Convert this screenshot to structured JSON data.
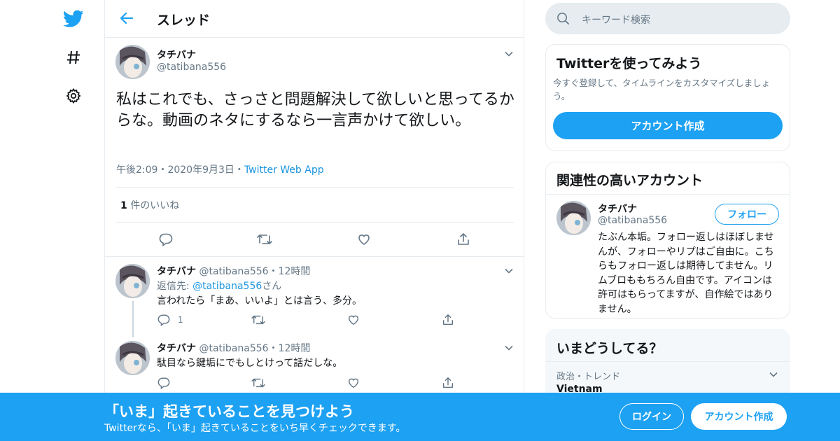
{
  "header": {
    "title": "スレッド"
  },
  "main_tweet": {
    "name": "タチバナ",
    "handle": "@tatibana556",
    "text": "私はこれでも、さっさと問題解決して欲しいと思ってるからな。動画のネタにするなら一言声かけて欲しい。",
    "time": "午後2:09",
    "date": "2020年9月3日",
    "source": "Twitter Web App",
    "dot": "・",
    "likes_count": "1",
    "likes_label": " 件のいいね"
  },
  "replies": [
    {
      "name": "タチバナ",
      "handle": "@tatibana556",
      "dot": "・",
      "time": "12時間",
      "reply_to_prefix": "返信先: ",
      "reply_to_handle": "@tatibana556",
      "reply_to_suffix": "さん",
      "text": "言われたら「まあ、いいよ」とは言う、多分。",
      "reply_count": "1"
    },
    {
      "name": "タチバナ",
      "handle": "@tatibana556",
      "dot": "・",
      "time": "12時間",
      "text": "駄目なら鍵垢にでもしとけって話だしな。"
    }
  ],
  "search": {
    "placeholder": "キーワード検索"
  },
  "signup_card": {
    "title": "Twitterを使ってみよう",
    "desc": "今すぐ登録して、タイムラインをカスタマイズしましょう。",
    "button": "アカウント作成"
  },
  "related_card": {
    "title": "関連性の高いアカウント",
    "name": "タチバナ",
    "handle": "@tatibana556",
    "follow": "フォロー",
    "bio": "たぶん本垢。フォロー返しはほぼしませんが、フォローやリプはご自由に。こちらもフォロー返しは期待してません。リムブロももちろん自由です。アイコンは許可はもらってますが、自作絵ではありません。"
  },
  "trends_card": {
    "title": "いまどうしてる？",
    "category": "政治・トレンド",
    "trend": "Vietnam"
  },
  "banner": {
    "title": "「いま」起きていることを見つけよう",
    "subtitle": "Twitterなら、「いま」起きていることをいち早くチェックできます。",
    "login": "ログイン",
    "signup": "アカウント作成"
  },
  "colors": {
    "accent": "#1da1f2",
    "link": "#1b95e0",
    "muted": "#657786",
    "border": "#e6ecf0"
  }
}
